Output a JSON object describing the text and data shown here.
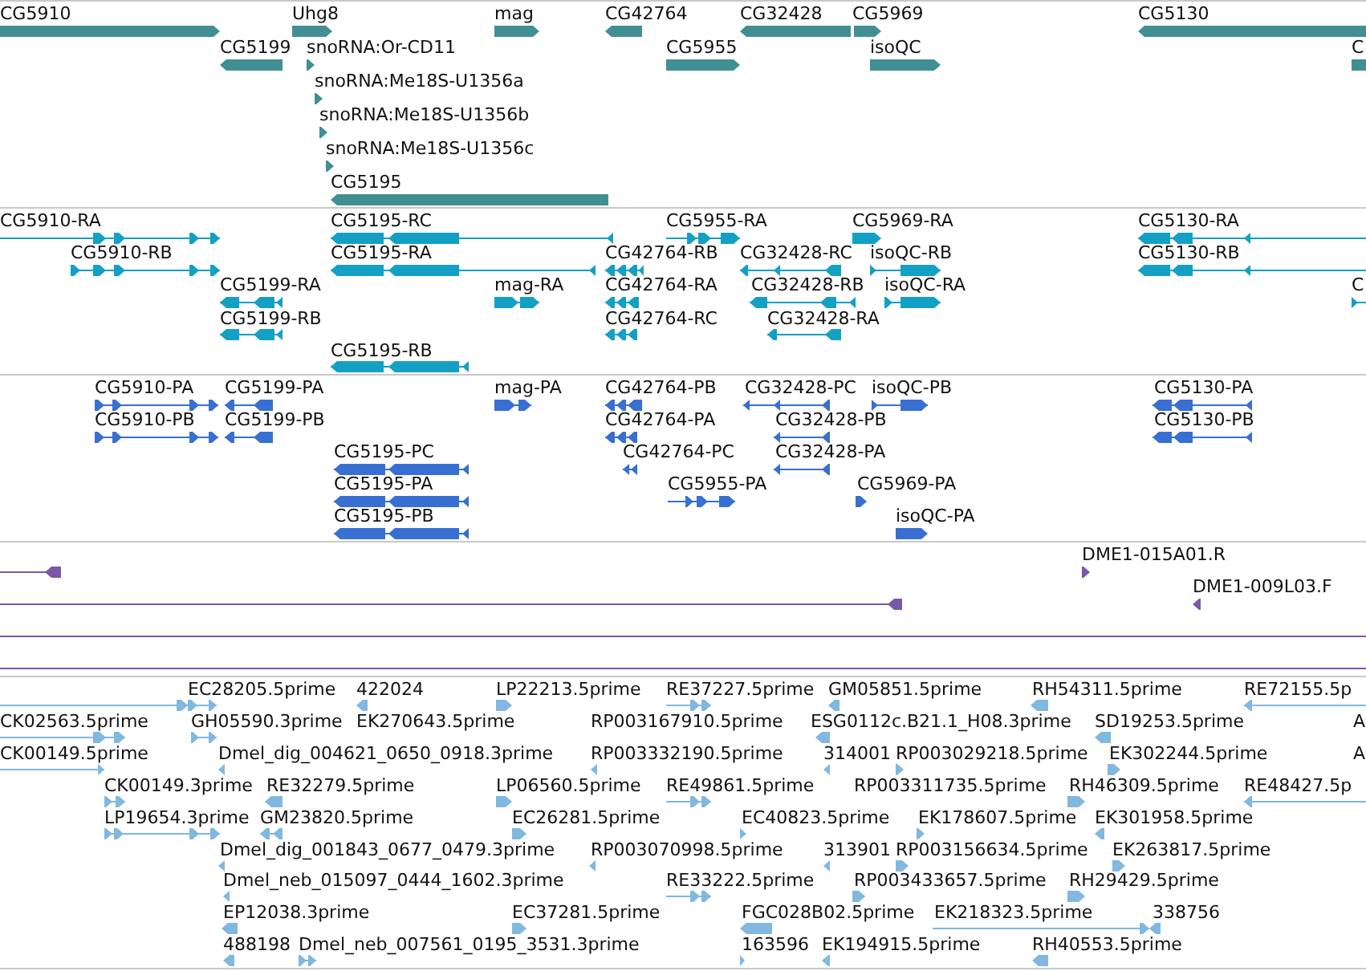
{
  "tracks": [
    {
      "kind": "genes",
      "color": "#418f94",
      "features": [
        {
          "label": "CG5910",
          "reverse": false
        },
        {
          "label": "Uhg8",
          "reverse": false
        },
        {
          "label": "mag",
          "reverse": false
        },
        {
          "label": "CG42764",
          "reverse": true
        },
        {
          "label": "CG32428",
          "reverse": true
        },
        {
          "label": "CG5969",
          "reverse": false
        },
        {
          "label": "CG5130",
          "reverse": true
        },
        {
          "label": "CG5199",
          "reverse": true
        },
        {
          "label": "snoRNA:Or-CD11",
          "reverse": false
        },
        {
          "label": "CG5955",
          "reverse": false
        },
        {
          "label": "isoQC",
          "reverse": false
        },
        {
          "label": "C"
        },
        {
          "label": "snoRNA:Me18S-U1356a",
          "reverse": false
        },
        {
          "label": "snoRNA:Me18S-U1356b",
          "reverse": false
        },
        {
          "label": "snoRNA:Me18S-U1356c",
          "reverse": false
        },
        {
          "label": "CG5195",
          "reverse": true
        }
      ]
    },
    {
      "kind": "transcripts",
      "color": "#14a0c5",
      "features": [
        {
          "label": "CG5910-RA",
          "reverse": false
        },
        {
          "label": "CG5195-RC",
          "reverse": true
        },
        {
          "label": "CG5955-RA",
          "reverse": false
        },
        {
          "label": "CG5969-RA",
          "reverse": false
        },
        {
          "label": "CG5130-RA",
          "reverse": true
        },
        {
          "label": "CG5910-RB",
          "reverse": false
        },
        {
          "label": "CG5195-RA",
          "reverse": true
        },
        {
          "label": "CG42764-RB",
          "reverse": true
        },
        {
          "label": "CG32428-RC",
          "reverse": true
        },
        {
          "label": "isoQC-RB",
          "reverse": false
        },
        {
          "label": "CG5130-RB",
          "reverse": true
        },
        {
          "label": "CG5199-RA",
          "reverse": true
        },
        {
          "label": "mag-RA",
          "reverse": false
        },
        {
          "label": "CG42764-RA",
          "reverse": true
        },
        {
          "label": "CG32428-RB",
          "reverse": true
        },
        {
          "label": "isoQC-RA",
          "reverse": false
        },
        {
          "label": "C",
          "reverse": false
        },
        {
          "label": "CG5199-RB",
          "reverse": true
        },
        {
          "label": "CG42764-RC",
          "reverse": true
        },
        {
          "label": "CG32428-RA",
          "reverse": true
        },
        {
          "label": "CG5195-RB",
          "reverse": true
        }
      ]
    },
    {
      "kind": "proteins",
      "color": "#3770d2",
      "features": [
        {
          "label": "CG5910-PA",
          "reverse": false
        },
        {
          "label": "CG5199-PA",
          "reverse": true
        },
        {
          "label": "mag-PA",
          "reverse": false
        },
        {
          "label": "CG42764-PB",
          "reverse": true
        },
        {
          "label": "CG32428-PC",
          "reverse": true
        },
        {
          "label": "isoQC-PB",
          "reverse": false
        },
        {
          "label": "CG5130-PA",
          "reverse": true
        },
        {
          "label": "CG5910-PB",
          "reverse": false
        },
        {
          "label": "CG5199-PB",
          "reverse": true
        },
        {
          "label": "CG42764-PA",
          "reverse": true
        },
        {
          "label": "CG32428-PB",
          "reverse": true
        },
        {
          "label": "CG5130-PB",
          "reverse": true
        },
        {
          "label": "CG5195-PC",
          "reverse": true
        },
        {
          "label": "CG42764-PC",
          "reverse": true
        },
        {
          "label": "CG32428-PA",
          "reverse": true
        },
        {
          "label": "CG5195-PA",
          "reverse": true
        },
        {
          "label": "CG5955-PA",
          "reverse": false
        },
        {
          "label": "CG5969-PA",
          "reverse": false
        },
        {
          "label": "CG5195-PB",
          "reverse": true
        },
        {
          "label": "isoQC-PA",
          "reverse": false
        }
      ]
    },
    {
      "kind": "clones",
      "color": "#7a58a8",
      "features": [
        {
          "reverse": true
        },
        {
          "label": "DME1-015A01.R",
          "reverse": false
        },
        {
          "reverse": true
        },
        {
          "label": "DME1-009L03.F",
          "reverse": true
        }
      ]
    },
    {
      "kind": "ests",
      "color": "#80b8e0",
      "features": [
        {
          "reverse": false
        },
        {
          "label": "EC28205.5prime",
          "reverse": false
        },
        {
          "label": "422024",
          "reverse": true
        },
        {
          "label": "LP22213.5prime",
          "reverse": false
        },
        {
          "label": "RE37227.5prime",
          "reverse": false
        },
        {
          "label": "GM05851.5prime",
          "reverse": true
        },
        {
          "label": "RH54311.5prime",
          "reverse": true
        },
        {
          "label": "RE72155.5p",
          "reverse": true
        },
        {
          "label": "CK02563.5prime",
          "reverse": false
        },
        {
          "label": "GH05590.3prime",
          "reverse": false
        },
        {
          "label": "EK270643.5prime"
        },
        {
          "label": "RP003167910.5prime"
        },
        {
          "label": "ESG0112c.B21.1_H08.3prime",
          "reverse": true
        },
        {
          "label": "SD19253.5prime",
          "reverse": true
        },
        {
          "label": "A"
        },
        {
          "label": "CK00149.5prime",
          "reverse": false
        },
        {
          "label": "Dmel_dig_004621_0650_0918.3prime",
          "reverse": true
        },
        {
          "label": "RP003332190.5prime",
          "reverse": true
        },
        {
          "label": "314001",
          "reverse": true
        },
        {
          "label": "RP003029218.5prime",
          "reverse": false
        },
        {
          "label": "EK302244.5prime",
          "reverse": false
        },
        {
          "label": "A"
        },
        {
          "label": "CK00149.3prime",
          "reverse": false
        },
        {
          "label": "RE32279.5prime",
          "reverse": true
        },
        {
          "label": "LP06560.5prime",
          "reverse": false
        },
        {
          "label": "RE49861.5prime",
          "reverse": false
        },
        {
          "label": "RP003311735.5prime"
        },
        {
          "label": "RH46309.5prime",
          "reverse": false
        },
        {
          "label": "RE48427.5p",
          "reverse": true
        },
        {
          "label": "LP19654.3prime",
          "reverse": false
        },
        {
          "label": "GM23820.5prime",
          "reverse": true
        },
        {
          "label": "EC26281.5prime",
          "reverse": false
        },
        {
          "label": "EC40823.5prime",
          "reverse": false
        },
        {
          "label": "EK178607.5prime",
          "reverse": false
        },
        {
          "label": "EK301958.5prime",
          "reverse": true
        },
        {
          "label": "Dmel_dig_001843_0677_0479.3prime",
          "reverse": true
        },
        {
          "label": "RP003070998.5prime",
          "reverse": true
        },
        {
          "label": "313901",
          "reverse": true
        },
        {
          "label": "RP003156634.5prime",
          "reverse": false
        },
        {
          "label": "EK263817.5prime",
          "reverse": false
        },
        {
          "label": "Dmel_neb_015097_0444_1602.3prime",
          "reverse": true
        },
        {
          "label": "RE33222.5prime",
          "reverse": false
        },
        {
          "label": "RP003433657.5prime",
          "reverse": false
        },
        {
          "label": "RH29429.5prime",
          "reverse": false
        },
        {
          "label": "EP12038.3prime",
          "reverse": true
        },
        {
          "label": "EC37281.5prime",
          "reverse": false
        },
        {
          "label": "FGC028B02.5prime",
          "reverse": true
        },
        {
          "label": "EK218323.5prime",
          "reverse": false
        },
        {
          "label": "338756",
          "reverse": true
        },
        {
          "label": "488198",
          "reverse": true
        },
        {
          "label": "Dmel_neb_007561_0195_3531.3prime",
          "reverse": false
        },
        {
          "label": "163596",
          "reverse": false
        },
        {
          "label": "EK194915.5prime",
          "reverse": true
        },
        {
          "label": "RH40553.5prime",
          "reverse": true
        }
      ]
    }
  ]
}
